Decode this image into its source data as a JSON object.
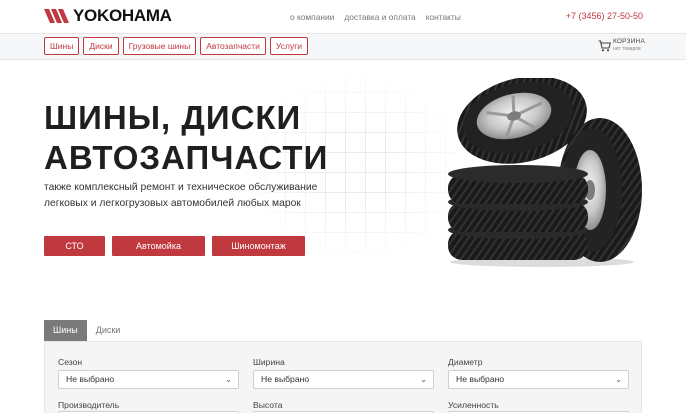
{
  "header": {
    "logo_text": "YOKOHAMA",
    "nav": [
      "о компании",
      "доставка и оплата",
      "контакты"
    ],
    "phone": "+7 (3456) 27-50-50"
  },
  "categories": [
    "Шины",
    "Диски",
    "Грузовые шины",
    "Автозапчасти",
    "Услуги"
  ],
  "cart": {
    "label": "КОРЗИНА",
    "sub": "нет товаров",
    "icon": "cart-icon"
  },
  "hero": {
    "title_line1": "ШИНЫ, ДИСКИ",
    "title_line2": "АВТОЗАПЧАСТИ",
    "subtitle_line1": "также комплексный ремонт и техническое обслуживание",
    "subtitle_line2": "легковых и легкогрузовых автомобилей любых марок",
    "buttons": [
      "СТО",
      "Автомойка",
      "Шиномонтаж"
    ]
  },
  "search": {
    "tabs": [
      "Шины",
      "Диски"
    ],
    "active_tab": "Шины",
    "fields": [
      {
        "label": "Сезон",
        "value": "Не выбрано"
      },
      {
        "label": "Ширина",
        "value": "Не выбрано"
      },
      {
        "label": "Диаметр",
        "value": "Не выбрано"
      },
      {
        "label": "Производитель",
        "value": ""
      },
      {
        "label": "Высота",
        "value": ""
      },
      {
        "label": "Усиленность",
        "value": ""
      }
    ]
  },
  "colors": {
    "accent": "#c0393f",
    "tab_active": "#7a7a7a",
    "panel": "#f5f5f5"
  }
}
